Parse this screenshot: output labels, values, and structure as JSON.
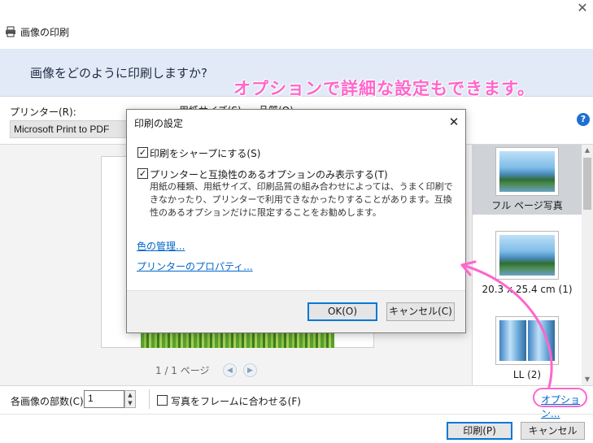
{
  "window": {
    "title": "画像の印刷",
    "close_glyph": "✕"
  },
  "banner": {
    "question": "画像をどのように印刷しますか?",
    "annotation": "オプションで詳細な設定もできます。"
  },
  "printer": {
    "label": "プリンター(R):",
    "value": "Microsoft Print to PDF",
    "paper_size_label": "用紙サイズ(S)",
    "quality_label": "品質(Q)"
  },
  "help_icon": "?",
  "preview": {
    "page_indicator": "1 / 1 ページ",
    "prev_glyph": "◀",
    "next_glyph": "▶"
  },
  "layouts": [
    {
      "caption": "フル ページ写真",
      "selected": true
    },
    {
      "caption": "20.3 x 25.4 cm (1)",
      "selected": false
    },
    {
      "caption": "LL (2)",
      "selected": false
    }
  ],
  "bottom": {
    "copies_label": "各画像の部数(C):",
    "copies_value": "1",
    "fit_label": "写真をフレームに合わせる(F)",
    "fit_checked": false,
    "options_link": "オプション...",
    "print_button": "印刷(P)",
    "cancel_button": "キャンセル"
  },
  "modal": {
    "title": "印刷の設定",
    "close_glyph": "✕",
    "sharpen_label": "印刷をシャープにする(S)",
    "sharpen_checked": true,
    "compat_label": "プリンターと互換性のあるオプションのみ表示する(T)",
    "compat_checked": true,
    "compat_description": "用紙の種類、用紙サイズ、印刷品質の組み合わせによっては、うまく印刷できなかったり、プリンターで利用できなかったりすることがあります。互換性のあるオプションだけに限定することをお勧めします。",
    "color_link": "色の管理...",
    "printer_props_link": "プリンターのプロパティ...",
    "ok_button": "OK(O)",
    "cancel_button": "キャンセル(C)",
    "check_glyph": "✓"
  },
  "colors": {
    "accent": "#0078d7",
    "annotation": "#ff66cc",
    "link": "#0066cc",
    "banner_bg": "#e1eaf6"
  },
  "icons": [
    "printer-icon",
    "close-icon",
    "help-icon",
    "check-icon",
    "arrow-annotation"
  ]
}
